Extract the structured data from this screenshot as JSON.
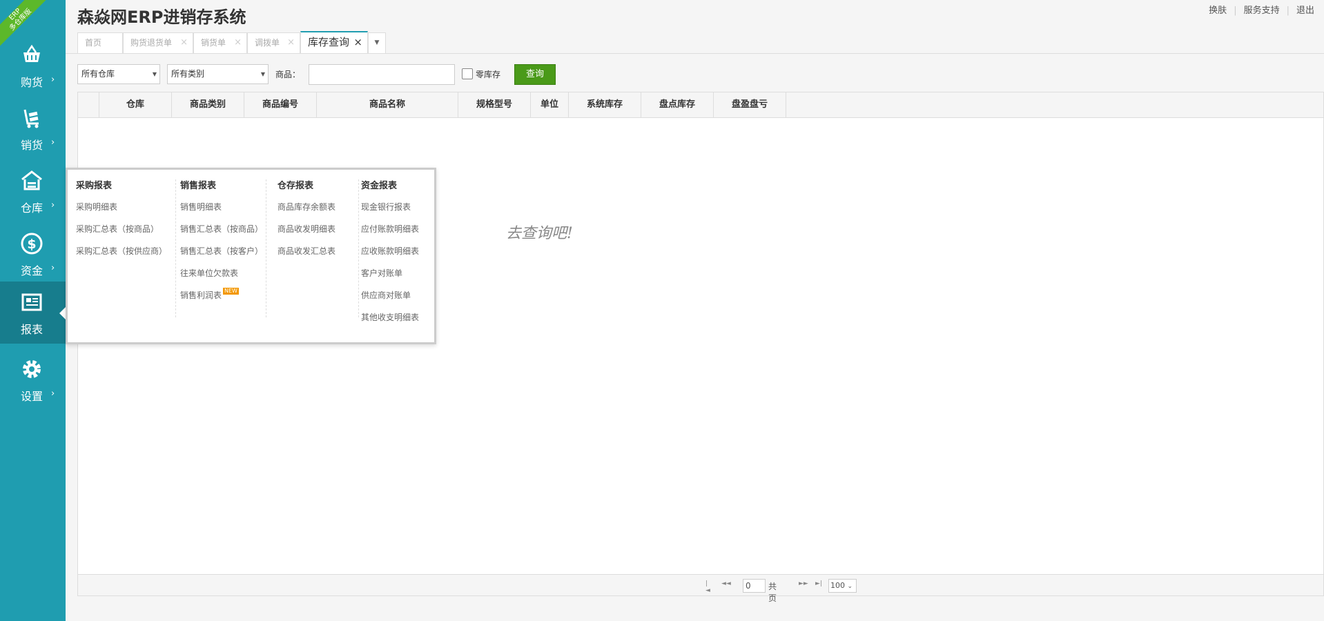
{
  "brand_ribbon": {
    "line1": "ERP",
    "line2": "多仓库版"
  },
  "app_title": "森焱网ERP进销存系统",
  "top_links": [
    "换肤",
    "服务支持",
    "退出"
  ],
  "sidebar": {
    "items": [
      {
        "label": "购货",
        "icon": "basket-icon"
      },
      {
        "label": "销货",
        "icon": "cart-icon"
      },
      {
        "label": "仓库",
        "icon": "warehouse-icon"
      },
      {
        "label": "资金",
        "icon": "dollar-icon"
      },
      {
        "label": "报表",
        "icon": "report-icon",
        "active": true
      },
      {
        "label": "设置",
        "icon": "gear-icon"
      }
    ],
    "arrow": "›"
  },
  "tabs": [
    {
      "label": "首页"
    },
    {
      "label": "购货退货单"
    },
    {
      "label": "销货单"
    },
    {
      "label": "调拨单"
    },
    {
      "label": "库存查询",
      "active": true
    }
  ],
  "toolbar": {
    "warehouse_select": "所有仓库",
    "category_select": "所有类别",
    "product_label": "商品：",
    "product_value": "",
    "zero_stock_label": "零库存",
    "zero_stock_checked": false,
    "query_button": "查询"
  },
  "grid": {
    "columns": [
      "仓库",
      "商品类别",
      "商品编号",
      "商品名称",
      "规格型号",
      "单位",
      "系统库存",
      "盘点库存",
      "盘盈盘亏"
    ],
    "rows": [],
    "empty_message_visible": "去查询吧!"
  },
  "pager": {
    "page_value": "0",
    "total_text": "共   页",
    "page_size": "100"
  },
  "report_menu": {
    "columns": [
      {
        "title": "采购报表",
        "items": [
          "采购明细表",
          "采购汇总表（按商品）",
          "采购汇总表（按供应商）"
        ]
      },
      {
        "title": "销售报表",
        "items": [
          "销售明细表",
          "销售汇总表（按商品）",
          "销售汇总表（按客户）",
          "往来单位欠款表",
          "销售利润表"
        ],
        "new_badge": "NEW"
      },
      {
        "title": "仓存报表",
        "items": [
          "商品库存余额表",
          "商品收发明细表",
          "商品收发汇总表"
        ]
      },
      {
        "title": "资金报表",
        "items": [
          "现金银行报表",
          "应付账款明细表",
          "应收账款明细表",
          "客户对账单",
          "供应商对账单",
          "其他收支明细表"
        ]
      }
    ]
  },
  "colors": {
    "sidebar_bg": "#1f9db0",
    "sidebar_active": "#177d8d",
    "query_button": "#4a9a19",
    "ribbon": "#5cb82a",
    "new_badge": "#f39700"
  }
}
